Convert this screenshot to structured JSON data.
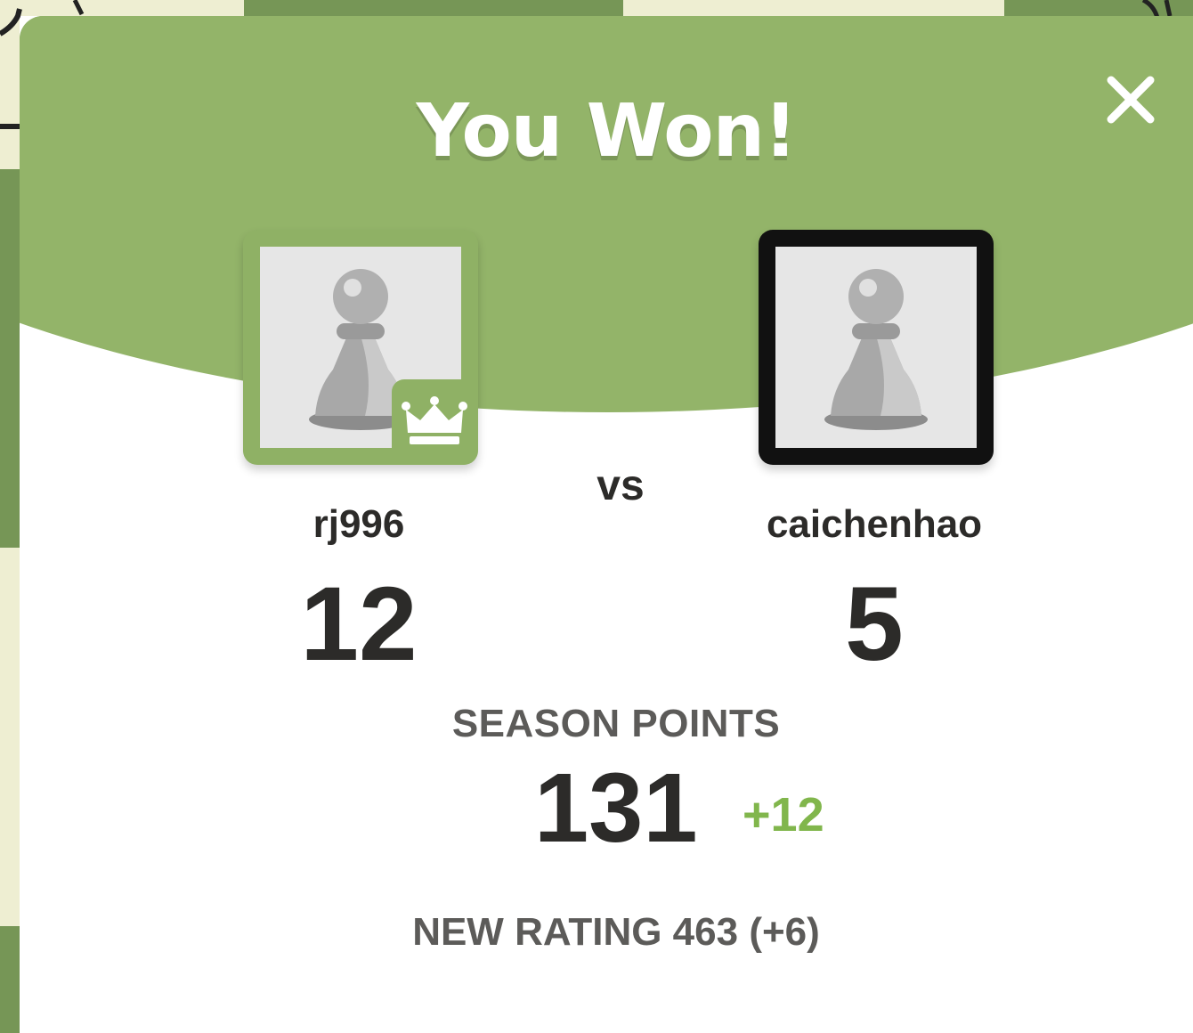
{
  "colors": {
    "banner": "#93b469",
    "winner_frame": "#8fb165",
    "loser_frame": "#111111",
    "text_dark": "#2c2b29",
    "text_gray": "#5c5b59",
    "delta_green": "#81b64c",
    "board_light": "#eeeed2",
    "board_dark": "#769656"
  },
  "modal": {
    "title": "You Won!",
    "close_icon": "close-icon",
    "vs_label": "vs",
    "players": [
      {
        "username": "rj996",
        "score": "12",
        "avatar_icon": "pawn-icon",
        "badge_icon": "crown-icon"
      },
      {
        "username": "caichenhao",
        "score": "5",
        "avatar_icon": "pawn-icon"
      }
    ],
    "season": {
      "label": "SEASON POINTS",
      "points": "131",
      "delta": "+12"
    },
    "rating_text": "NEW RATING 463 (+6)"
  }
}
